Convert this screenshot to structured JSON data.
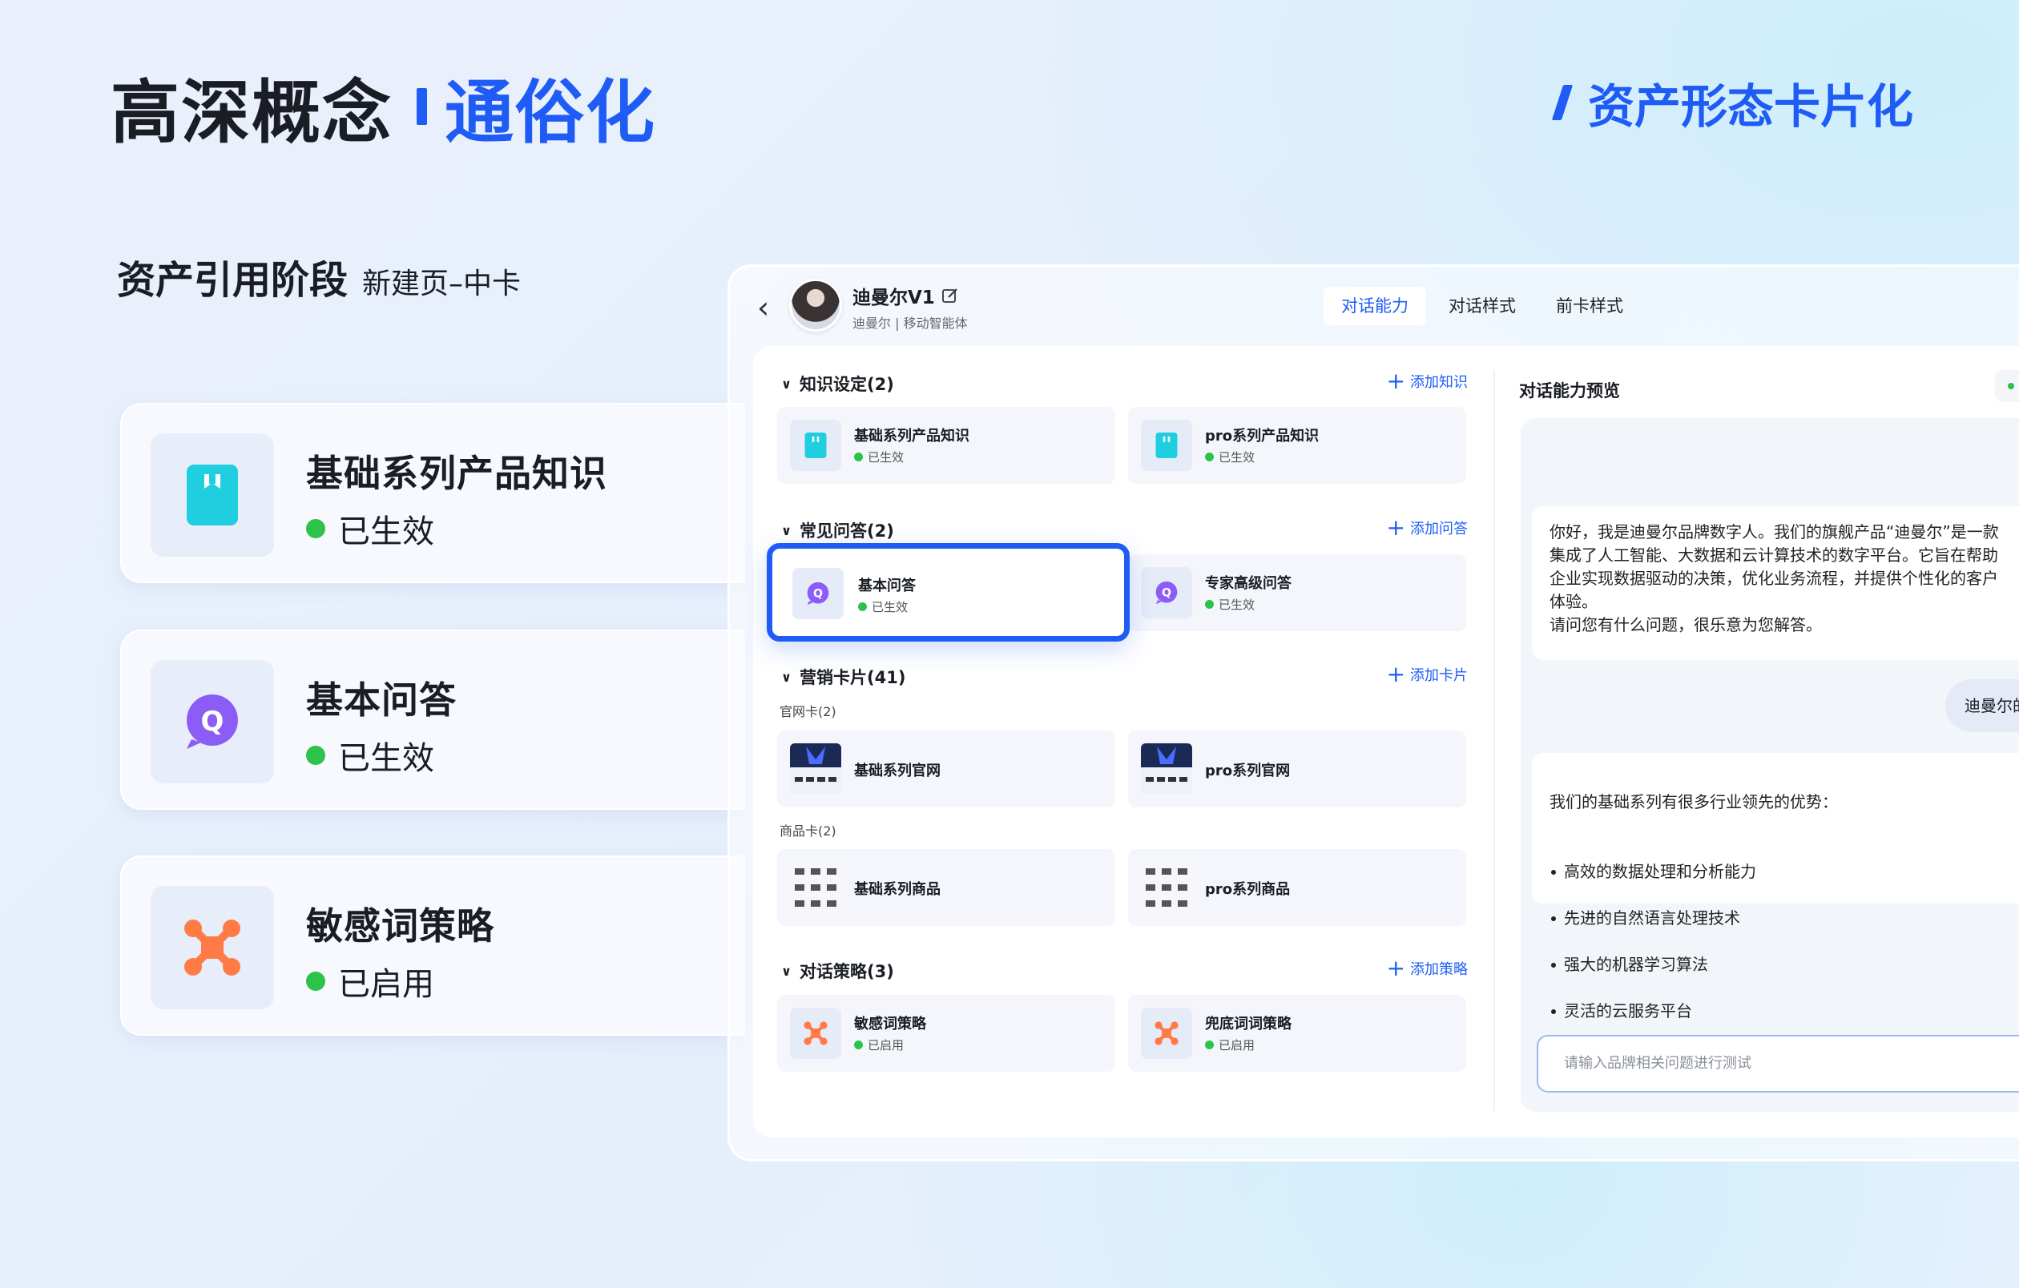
{
  "header": {
    "title_black": "高深概念",
    "title_blue": "通俗化",
    "right_label": "资产形态卡片化"
  },
  "stage": {
    "main": "资产引用阶段",
    "sub": "新建页–中卡"
  },
  "big_cards": [
    {
      "name": "基础系列产品知识",
      "status": "已生效",
      "icon": "bookmark-icon"
    },
    {
      "name": "基本问答",
      "status": "已生效",
      "icon": "qa-chat-icon"
    },
    {
      "name": "敏感词策略",
      "status": "已启用",
      "icon": "strategy-cross-icon"
    }
  ],
  "app": {
    "back": "‹",
    "agent_name": "迪曼尔V1",
    "agent_sub": "迪曼尔 |  移动智能体",
    "tabs": [
      {
        "label": "对话能力",
        "active": true
      },
      {
        "label": "对话样式",
        "active": false
      },
      {
        "label": "前卡样式",
        "active": false
      }
    ],
    "sections": {
      "knowledge": {
        "title": "知识设定(2)",
        "add": "添加知识",
        "items": [
          {
            "name": "基础系列产品知识",
            "status": "已生效"
          },
          {
            "name": "pro系列产品知识",
            "status": "已生效"
          }
        ]
      },
      "faq": {
        "title": "常见问答(2)",
        "add": "添加问答",
        "items": [
          {
            "name": "基本问答",
            "status": "已生效"
          },
          {
            "name": "专家高级问答",
            "status": "已生效"
          }
        ]
      },
      "cards": {
        "title": "营销卡片(41)",
        "add": "添加卡片",
        "official_label": "官网卡(2)",
        "official": [
          {
            "name": "基础系列官网"
          },
          {
            "name": "pro系列官网"
          }
        ],
        "product_label": "商品卡(2)",
        "products": [
          {
            "name": "基础系列商品"
          },
          {
            "name": "pro系列商品"
          }
        ]
      },
      "strategy": {
        "title": "对话策略(3)",
        "add": "添加策略",
        "items": [
          {
            "name": "敏感词策略",
            "status": "已启用"
          },
          {
            "name": "兜底词词策略",
            "status": "已启用"
          }
        ]
      }
    },
    "preview": {
      "title": "对话能力预览",
      "bot_msg_1": "你好，我是迪曼尔品牌数字人。我们的旗舰产品“迪曼尔”是一款\n集成了人工智能、大数据和云计算技术的数字平台。它旨在帮助\n企业实现数据驱动的决策，优化业务流程，并提供个性化的客户\n体验。\n请问您有什么问题，很乐意为您解答。",
      "user_msg": "迪曼尔的",
      "bot_msg_2_intro": "我们的基础系列有很多行业领先的优势：",
      "bot_msg_2_points": [
        "高效的数据处理和分析能力",
        "先进的自然语言处理技术",
        "强大的机器学习算法",
        "灵活的云服务平台"
      ],
      "input_placeholder": "请输入品牌相关问题进行测试"
    }
  },
  "colors": {
    "accent": "#1f5cf5",
    "status_green": "#2dc24a",
    "knowledge_icon": "#1fcfe0",
    "qa_icon": "#8b5cf6",
    "strategy_icon": "#ff7a45"
  }
}
